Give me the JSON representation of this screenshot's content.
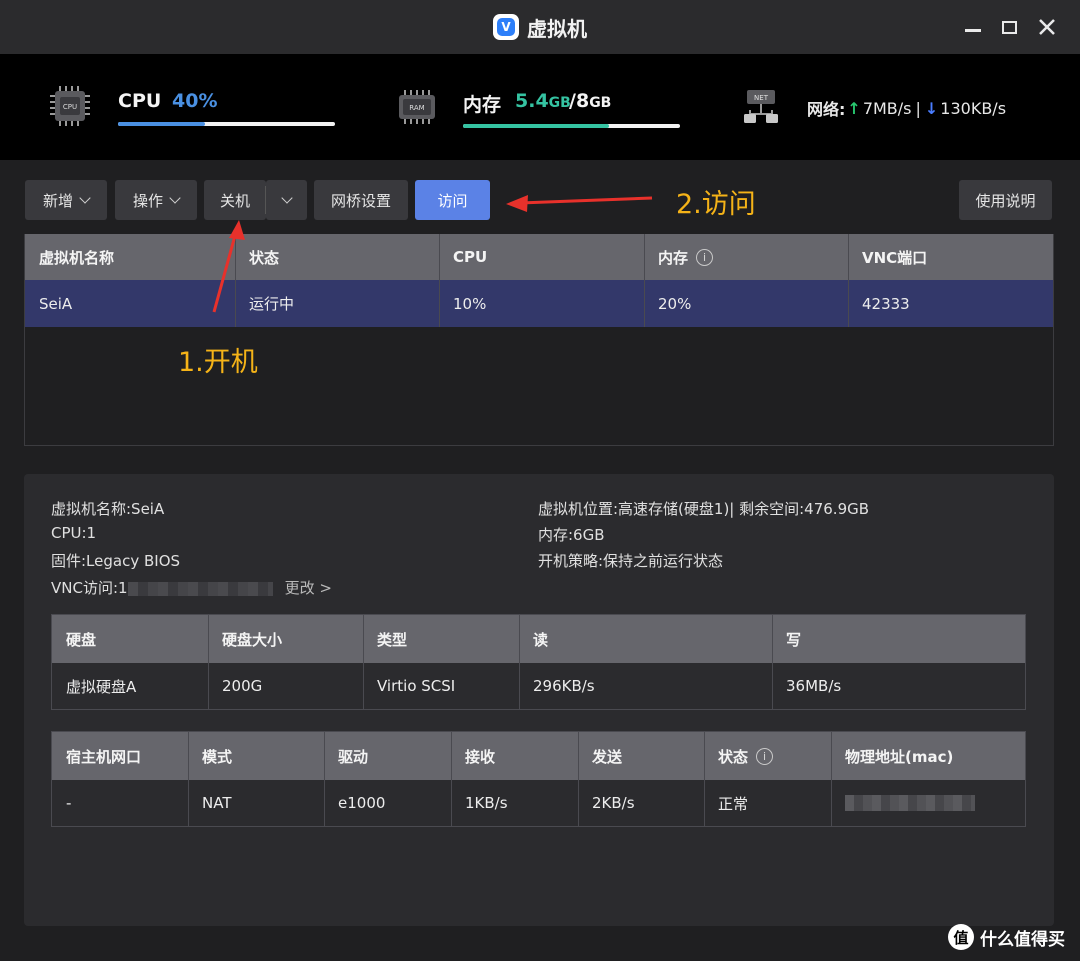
{
  "window": {
    "title": "虚拟机",
    "logo_letter": "V"
  },
  "stats": {
    "cpu": {
      "label": "CPU",
      "value": "40%",
      "fraction": 0.4,
      "icon": "cpu-chip-icon",
      "chip_text": "CPU"
    },
    "memory": {
      "label": "内存",
      "used": "5.4",
      "used_unit": "GB",
      "separator": "/",
      "total": "8",
      "total_unit": "GB",
      "fraction": 0.675,
      "icon": "ram-icon",
      "chip_text": "RAM"
    },
    "network": {
      "label": "网络:",
      "up": "7MB/s",
      "divider": "|",
      "down": "130KB/s",
      "icon": "network-icon",
      "chip_text": "NET"
    },
    "colors": {
      "cpu": "#4a90e2",
      "memory": "#35c3a2"
    }
  },
  "toolbar": {
    "add": "新增",
    "actions": "操作",
    "shutdown": "关机",
    "bridge": "网桥设置",
    "visit": "访问",
    "help": "使用说明"
  },
  "annotations": {
    "step1": "1.开机",
    "step2": "2.访问",
    "color": "#f5b318",
    "arrow_color": "#e8312b"
  },
  "vm_table": {
    "headers": [
      "虚拟机名称",
      "状态",
      "CPU",
      "内存",
      "VNC端口"
    ],
    "rows": [
      [
        "SeiA",
        "运行中",
        "10%",
        "20%",
        "42333"
      ]
    ]
  },
  "details": {
    "name": "虚拟机名称:SeiA",
    "cpu": "CPU:1",
    "firmware": "固件:Legacy BIOS",
    "vnc_label": "VNC访问:1",
    "vnc_change": "更改 >",
    "location": "虚拟机位置:高速存储(硬盘1)| 剩余空间:476.9GB",
    "memory": "内存:6GB",
    "boot_policy": "开机策略:保持之前运行状态"
  },
  "disk_table": {
    "headers": [
      "硬盘",
      "硬盘大小",
      "类型",
      "读",
      "写"
    ],
    "rows": [
      [
        "虚拟硬盘A",
        "200G",
        "Virtio SCSI",
        "296KB/s",
        "36MB/s"
      ]
    ]
  },
  "nic_table": {
    "headers": [
      "宿主机网口",
      "模式",
      "驱动",
      "接收",
      "发送",
      "状态",
      "物理地址(mac)"
    ],
    "rows": [
      [
        "-",
        "NAT",
        "e1000",
        "1KB/s",
        "2KB/s",
        "正常",
        ""
      ]
    ]
  },
  "watermark": {
    "text": "什么值得买",
    "logo": "值"
  }
}
